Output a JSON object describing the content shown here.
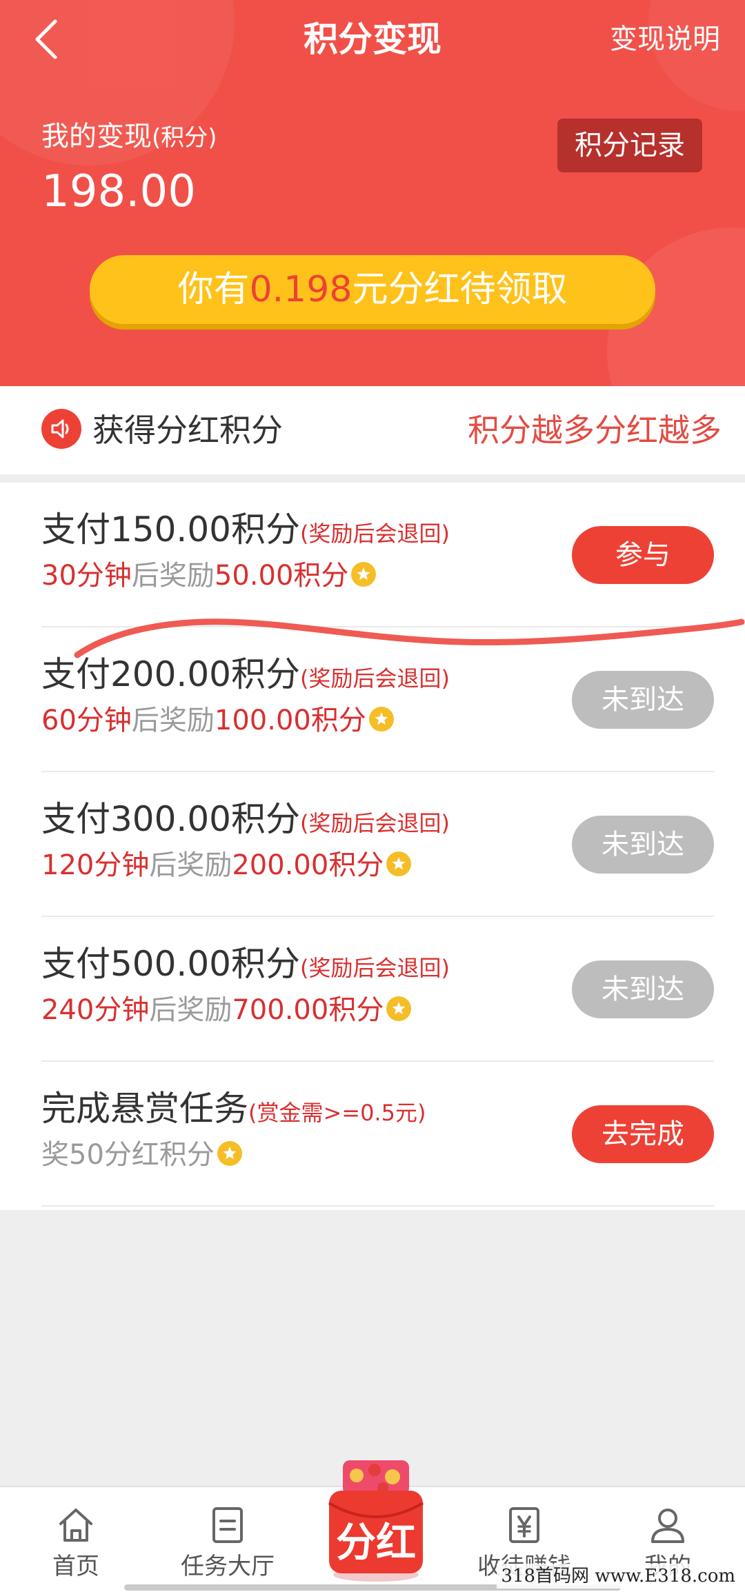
{
  "header": {
    "title": "积分变现",
    "explain_link": "变现说明",
    "balance_label": "我的变现",
    "balance_unit": "(积分)",
    "balance_value": "198.00",
    "record_button": "积分记录",
    "dividend_prefix": "你有",
    "dividend_amount": "0.198",
    "dividend_suffix": "元分红待领取"
  },
  "notice": {
    "title": "获得分红积分",
    "slogan": "积分越多分红越多"
  },
  "tasks": [
    {
      "title": "支付150.00积分",
      "note": "(奖励后会退回)",
      "duration": "30分钟",
      "middle": "后奖励",
      "reward": "50.00积分",
      "button": "参与",
      "button_state": "active"
    },
    {
      "title": "支付200.00积分",
      "note": "(奖励后会退回)",
      "duration": "60分钟",
      "middle": "后奖励",
      "reward": "100.00积分",
      "button": "未到达",
      "button_state": "disabled"
    },
    {
      "title": "支付300.00积分",
      "note": "(奖励后会退回)",
      "duration": "120分钟",
      "middle": "后奖励",
      "reward": "200.00积分",
      "button": "未到达",
      "button_state": "disabled"
    },
    {
      "title": "支付500.00积分",
      "note": "(奖励后会退回)",
      "duration": "240分钟",
      "middle": "后奖励",
      "reward": "700.00积分",
      "button": "未到达",
      "button_state": "disabled"
    },
    {
      "title": "完成悬赏任务",
      "note": "(赏金需>=0.5元)",
      "reward_text": "奖50分红积分",
      "button": "去完成",
      "button_state": "active"
    }
  ],
  "bottom_nav": {
    "items": [
      {
        "label": "首页",
        "icon": "home-icon"
      },
      {
        "label": "任务大厅",
        "icon": "document-icon"
      },
      {
        "label": "收徒赚钱",
        "icon": "yen-icon"
      },
      {
        "label": "我的",
        "icon": "person-icon"
      }
    ],
    "center_label": "分红"
  },
  "watermark": "318首码网 www.E318.com",
  "colors": {
    "header_red": "#f15048",
    "accent_red": "#ee4135",
    "gold": "#ffc21a",
    "disabled_grey": "#bdbdbd"
  }
}
